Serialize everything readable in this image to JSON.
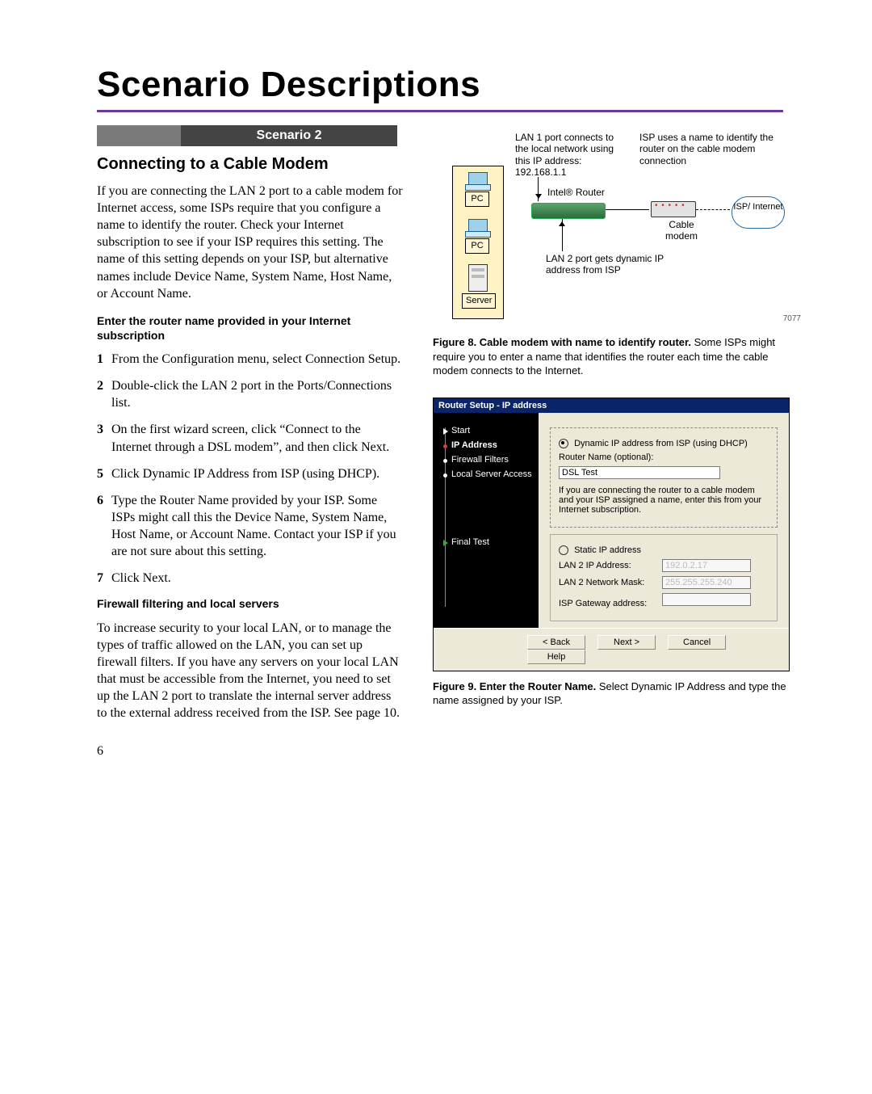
{
  "page_number": "6",
  "title": "Scenario Descriptions",
  "scenario_label": "Scenario 2",
  "section_title": "Connecting to a Cable Modem",
  "intro_para": "If you are connecting the LAN 2 port to a cable modem for Internet access, some ISPs require that you configure a name to identify the router. Check your Internet subscription to see if your ISP requires this setting. The name of this setting depends on your ISP, but alternative names include Device Name, System Name, Host Name, or Account Name.",
  "sub1_heading": "Enter the router name provided in your Internet subscription",
  "steps": [
    {
      "n": "1",
      "t": "From the Configuration menu, select Connection Setup."
    },
    {
      "n": "2",
      "t": "Double-click the LAN 2 port in the Ports/Connections list."
    },
    {
      "n": "3",
      "t": "On the first wizard screen, click “Connect to the Internet through a DSL modem”, and then click Next."
    },
    {
      "n": "5",
      "t": "Click Dynamic IP Address from ISP (using DHCP)."
    },
    {
      "n": "6",
      "t": "Type the Router Name provided by your ISP. Some ISPs might call this the Device Name, System Name, Host Name, or Account Name. Contact your ISP if you are not sure about this setting."
    },
    {
      "n": "7",
      "t": "Click Next."
    }
  ],
  "sub2_heading": "Firewall filtering and local servers",
  "sub2_para": "To increase security to your local LAN, or to manage the types of traffic allowed on the LAN, you can set up firewall filters. If you have any servers on your local LAN that must be accessible from the Internet, you need to set up the LAN 2 port to translate the internal server address to the external address received from the ISP. See page 10.",
  "diagram": {
    "id_tag": "7077",
    "lan1_text": "LAN 1 port connects to the local network using this IP address: 192.168.1.1",
    "isp_text": "ISP uses a name to identify the router on the cable modem connection",
    "router_label": "Intel® Router",
    "cable_modem": "Cable modem",
    "isp_cloud": "ISP/ Internet",
    "lan2_text": "LAN 2 port gets dynamic IP address from ISP",
    "pc_label": "PC",
    "server_label": "Server"
  },
  "fig8_caption_bold": "Figure 8. Cable modem with name to identify router.",
  "fig8_caption_rest": " Some ISPs might require you to enter a name that identifies the router each time the cable modem connects to the Internet.",
  "dialog": {
    "title": "Router Setup - IP address",
    "nav": {
      "start": "Start",
      "ip": "IP Address",
      "firewall": "Firewall Filters",
      "local": "Local Server Access",
      "final": "Final Test"
    },
    "opt_dynamic": "Dynamic IP address from ISP (using DHCP)",
    "router_name_label": "Router Name (optional):",
    "router_name_value": "DSL Test",
    "hint": "If you are connecting the router to a cable modem and your ISP assigned a name, enter this from your Internet subscription.",
    "opt_static": "Static IP address",
    "lan2_ip_label": "LAN 2 IP Address:",
    "lan2_ip_value": "192.0.2.17",
    "lan2_mask_label": "LAN 2 Network Mask:",
    "lan2_mask_value": "255.255.255.240",
    "gw_label": "ISP Gateway address:",
    "buttons": {
      "back": "< Back",
      "next": "Next >",
      "cancel": "Cancel",
      "help": "Help"
    }
  },
  "fig9_caption_bold": "Figure 9. Enter the Router Name.",
  "fig9_caption_rest": " Select Dynamic IP Address and type the name assigned by your ISP."
}
